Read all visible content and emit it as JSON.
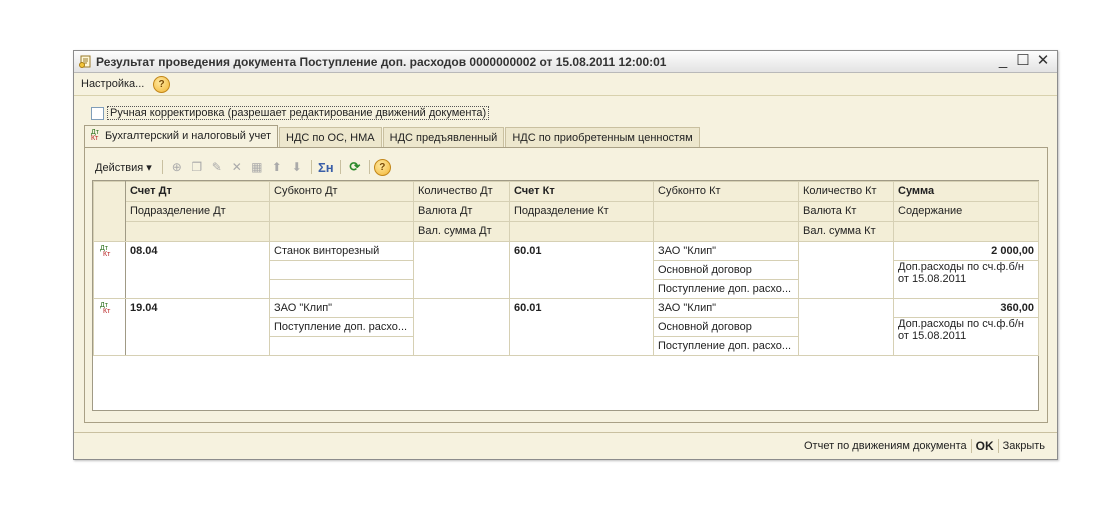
{
  "window": {
    "title": "Результат проведения документа Поступление доп. расходов 0000000002 от 15.08.2011 12:00:01",
    "controls": [
      "_",
      "☐",
      "✕"
    ]
  },
  "menu": {
    "settings": "Настройка...",
    "help": "?"
  },
  "checkbox": {
    "label": "Ручная корректировка (разрешает редактирование движений документа)",
    "checked": false
  },
  "tabs": [
    {
      "label": "Бухгалтерский и налоговый учет",
      "active": true,
      "icon": "dt-kt-icon"
    },
    {
      "label": "НДС по ОС, НМА"
    },
    {
      "label": "НДС предъявленный"
    },
    {
      "label": "НДС по приобретенным ценностям"
    }
  ],
  "toolbar": {
    "actions": "Действия ▾",
    "sum": "Σн",
    "refresh": "⟳",
    "help": "?"
  },
  "table": {
    "header_row1": [
      "Счет Дт",
      "Субконто Дт",
      "Количество Дт",
      "Счет Кт",
      "Субконто Кт",
      "Количество Кт",
      "Сумма"
    ],
    "header_row2": [
      "Подразделение Дт",
      "",
      "Валюта Дт",
      "Подразделение Кт",
      "",
      "Валюта Кт",
      "Содержание"
    ],
    "header_row3": [
      "",
      "",
      "Вал. сумма Дт",
      "",
      "",
      "Вал. сумма Кт",
      ""
    ],
    "rows": [
      {
        "icon": "Дт Кт",
        "schet_dt": "08.04",
        "subkonto_dt": [
          "Станок винторезный",
          "",
          ""
        ],
        "schet_kt": "60.01",
        "subkonto_kt": [
          "ЗАО \"Клип\"",
          "Основной договор",
          "Поступление доп. расхо..."
        ],
        "summa": "2 000,00",
        "soderzhanie": "Доп.расходы по сч.ф.б/н от 15.08.2011"
      },
      {
        "icon": "Дт Кт",
        "schet_dt": "19.04",
        "subkonto_dt": [
          "ЗАО \"Клип\"",
          "Поступление доп. расхо...",
          ""
        ],
        "schet_kt": "60.01",
        "subkonto_kt": [
          "ЗАО \"Клип\"",
          "Основной договор",
          "Поступление доп. расхо..."
        ],
        "summa": "360,00",
        "soderzhanie": "Доп.расходы по сч.ф.б/н от 15.08.2011"
      }
    ]
  },
  "footer": {
    "report": "Отчет по движениям документа",
    "ok": "OK",
    "close": "Закрыть"
  }
}
